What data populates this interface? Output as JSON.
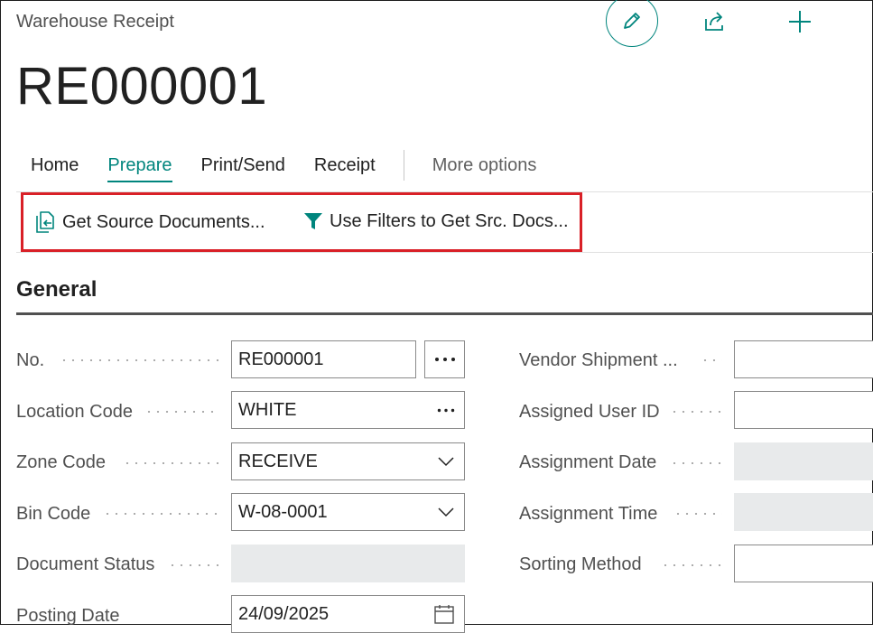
{
  "header": {
    "breadcrumb": "Warehouse Receipt",
    "title": "RE000001"
  },
  "action_icons": [
    "edit-icon",
    "share-icon",
    "new-icon"
  ],
  "tabs": [
    {
      "label": "Home",
      "active": false
    },
    {
      "label": "Prepare",
      "active": true
    },
    {
      "label": "Print/Send",
      "active": false
    },
    {
      "label": "Receipt",
      "active": false
    }
  ],
  "more_options": "More options",
  "commands": {
    "get_source_documents": "Get Source Documents...",
    "use_filters": "Use Filters to Get Src. Docs..."
  },
  "section": {
    "title": "General"
  },
  "left_fields": [
    {
      "label": "No.",
      "value": "RE000001",
      "control": "assist-external"
    },
    {
      "label": "Location Code",
      "value": "WHITE",
      "control": "assist-inline"
    },
    {
      "label": "Zone Code",
      "value": "RECEIVE",
      "control": "dropdown"
    },
    {
      "label": "Bin Code",
      "value": "W-08-0001",
      "control": "dropdown"
    },
    {
      "label": "Document Status",
      "value": "",
      "control": "readonly"
    },
    {
      "label": "Posting Date",
      "value": "24/09/2025",
      "control": "date"
    }
  ],
  "right_fields": [
    {
      "label": "Vendor Shipment ...",
      "value": "",
      "control": "text"
    },
    {
      "label": "Assigned User ID",
      "value": "",
      "control": "text"
    },
    {
      "label": "Assignment Date",
      "value": "",
      "control": "readonly"
    },
    {
      "label": "Assignment Time",
      "value": "",
      "control": "readonly"
    },
    {
      "label": "Sorting Method",
      "value": "",
      "control": "text"
    }
  ],
  "colors": {
    "accent": "#00857d",
    "highlight": "#d92027",
    "readonly_bg": "#e8eaeb"
  }
}
